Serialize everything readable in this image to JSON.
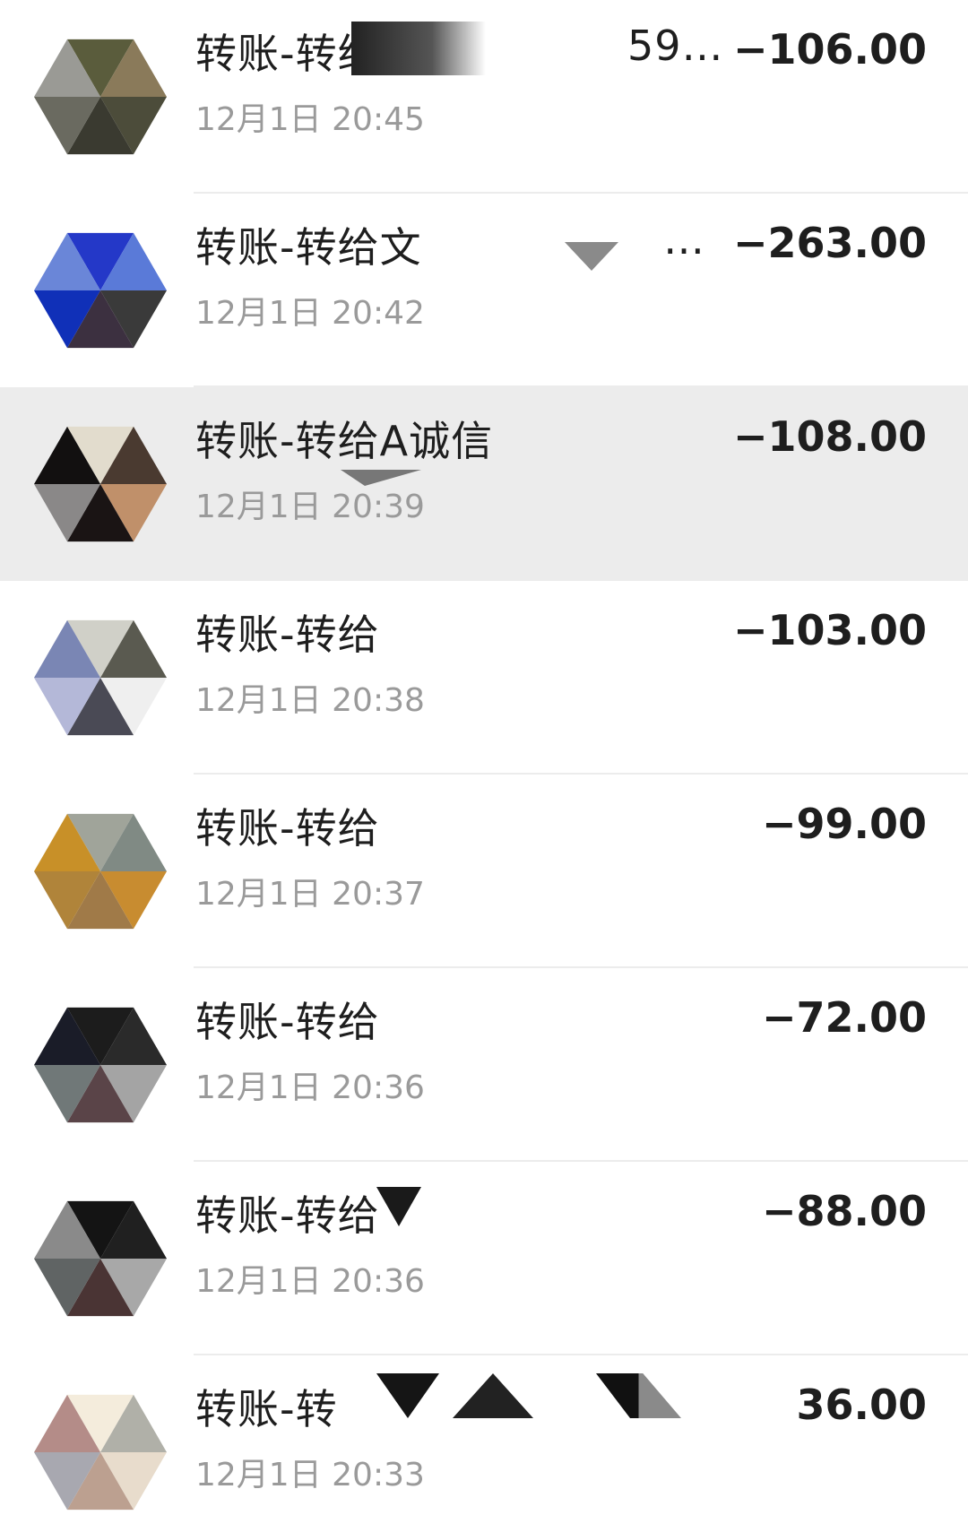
{
  "transactions": [
    {
      "title": "转账-转给",
      "tail": "59…",
      "time": "12月1日 20:45",
      "amount": "−106.00",
      "colors": [
        "#5a5c3c",
        "#8a7a5a",
        "#4c4c3a",
        "#3a3a30",
        "#6a6a60",
        "#9a9a95"
      ]
    },
    {
      "title": "转账-转给文",
      "tail": "…",
      "time": "12月1日 20:42",
      "amount": "−263.00",
      "colors": [
        "#2438c8",
        "#5a7ad8",
        "#3a3a3a",
        "#3c3040",
        "#1030b8",
        "#6a86d8"
      ]
    },
    {
      "title": "转账-转给A诚信",
      "tail": "",
      "time": "12月1日 20:39",
      "amount": "−108.00",
      "colors": [
        "#e2dccd",
        "#4a3a30",
        "#c0906a",
        "#1a1414",
        "#8a8888",
        "#121010"
      ]
    },
    {
      "title": "转账-转给",
      "tail": "",
      "time": "12月1日 20:38",
      "amount": "−103.00",
      "colors": [
        "#d0d0c8",
        "#5a5a50",
        "#efefef",
        "#4a4a55",
        "#b4b8d8",
        "#7a86b4"
      ]
    },
    {
      "title": "转账-转给",
      "tail": "",
      "time": "12月1日 20:37",
      "amount": "−99.00",
      "colors": [
        "#a0a49a",
        "#808a84",
        "#c88c30",
        "#a07a48",
        "#b0843a",
        "#c89028"
      ]
    },
    {
      "title": "转账-转给",
      "tail": "",
      "time": "12月1日 20:36",
      "amount": "−72.00",
      "colors": [
        "#1c1c1c",
        "#2a2a2a",
        "#a4a4a4",
        "#5a4448",
        "#707878",
        "#1a1c28"
      ]
    },
    {
      "title": "转账-转给",
      "tail": "",
      "time": "12月1日 20:36",
      "amount": "−88.00",
      "colors": [
        "#141414",
        "#202020",
        "#a8a8a8",
        "#4a3434",
        "#606464",
        "#8a8a8a"
      ]
    },
    {
      "title": "转账-转",
      "tail": "",
      "time": "12月1日 20:33",
      "amount": "36.00",
      "colors": [
        "#f4ecdc",
        "#b0b0a8",
        "#e8dccc",
        "#bca090",
        "#a8a8b0",
        "#b48c88"
      ]
    }
  ]
}
